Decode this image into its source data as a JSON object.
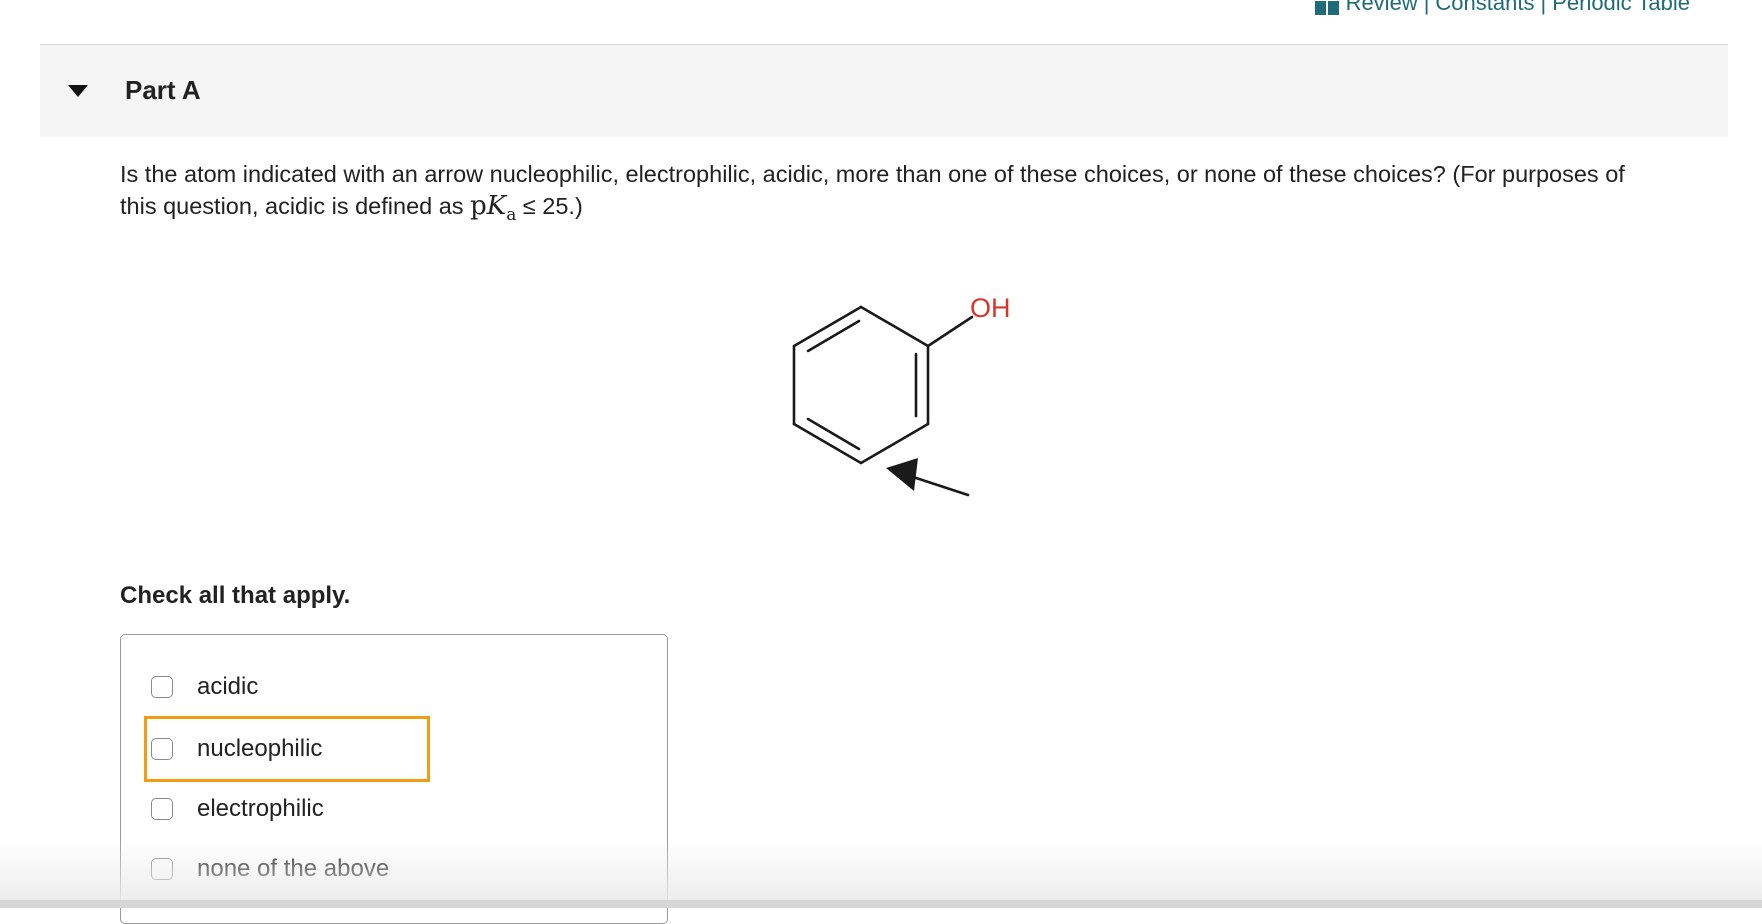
{
  "toplinks": {
    "review": "Review",
    "constants": "Constants",
    "periodic_table": "Periodic Table",
    "separator": "|"
  },
  "part": {
    "title": "Part A"
  },
  "question": {
    "text": "Is the atom indicated with an arrow nucleophilic, electrophilic, acidic, more than one of these choices, or none of these choices? (For purposes of this question, acidic is defined as ",
    "math_p": "p",
    "math_K": "K",
    "math_sub": "a",
    "math_rel": " ≤ 25.)"
  },
  "molecule": {
    "label": "OH",
    "label_color": "#d9342b"
  },
  "check_label": "Check all that apply.",
  "options": [
    {
      "label": "acidic",
      "checked": false
    },
    {
      "label": "nucleophilic",
      "checked": false,
      "focused": true
    },
    {
      "label": "electrophilic",
      "checked": false
    },
    {
      "label": "none of the above",
      "checked": false
    }
  ],
  "colors": {
    "link": "#1f6b7a",
    "focus_outline": "#f39c12",
    "header_bg": "#f5f5f5"
  }
}
